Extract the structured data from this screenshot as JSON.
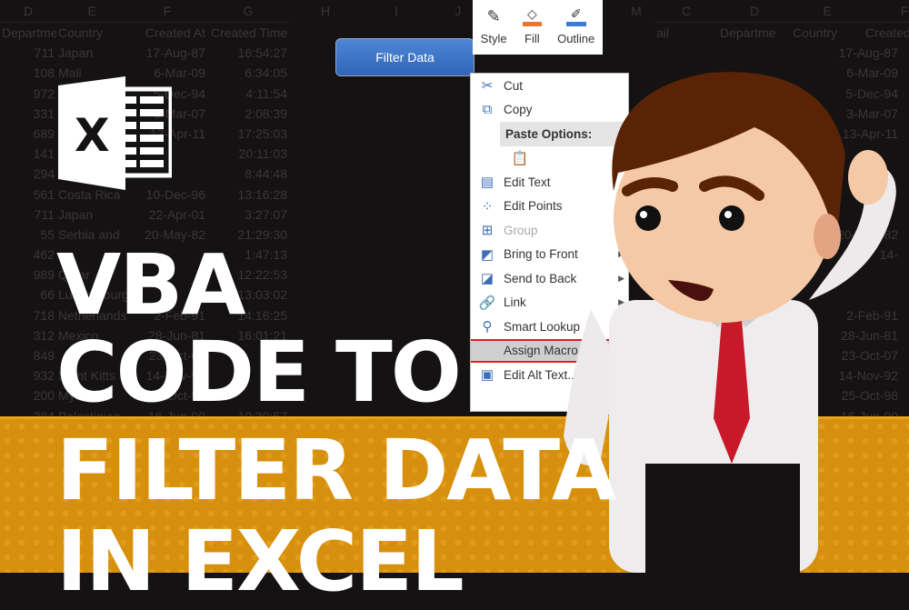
{
  "sheet_left": {
    "column_letters": [
      "D",
      "E",
      "F",
      "G",
      "H",
      "I",
      "J"
    ],
    "headers": [
      "Departme",
      "Country",
      "Created At",
      "Created Time"
    ],
    "rows": [
      [
        "711",
        "Japan",
        "17-Aug-87",
        "16:54:27"
      ],
      [
        "108",
        "Mali",
        "6-Mar-09",
        "6:34:05"
      ],
      [
        "972",
        "",
        "5-Dec-94",
        "4:11:54"
      ],
      [
        "331",
        "",
        "3-Mar-07",
        "2:08:39"
      ],
      [
        "689",
        "",
        "13-Apr-11",
        "17:25:03"
      ],
      [
        "141",
        "",
        "",
        "20:11:03"
      ],
      [
        "294",
        "",
        "",
        "8:44:48"
      ],
      [
        "561",
        "Costa Rica",
        "10-Dec-96",
        "13:16:28"
      ],
      [
        "711",
        "Japan",
        "22-Apr-01",
        "3:27:07"
      ],
      [
        "55",
        "Serbia and",
        "20-May-82",
        "21:29:30"
      ],
      [
        "462",
        "",
        "",
        "1:47:13"
      ],
      [
        "989",
        "Qatar",
        "",
        "12:22:53"
      ],
      [
        "66",
        "Luxembourg",
        "",
        "13:03:02"
      ],
      [
        "718",
        "Netherlands",
        "2-Feb-91",
        "14:16:25"
      ],
      [
        "312",
        "Mexico",
        "28-Jun-81",
        "16:01:21"
      ],
      [
        "849",
        "",
        "23-Oct-07",
        ""
      ],
      [
        "932",
        "Saint Kitts",
        "14-Nov-92",
        ""
      ],
      [
        "200",
        "Myanmar",
        "25-Oct-98",
        ""
      ],
      [
        "384",
        "Palestinian",
        "16-Jun-00",
        "10:30:57"
      ]
    ]
  },
  "sheet_right": {
    "column_letters": [
      "M",
      "C",
      "D",
      "E",
      "F"
    ],
    "headers": [
      "ail",
      "Departme",
      "Country",
      "Created At"
    ],
    "dates": [
      "17-Aug-87",
      "6-Mar-09",
      "5-Dec-94",
      "3-Mar-07",
      "13-Apr-11",
      "",
      "",
      "",
      "",
      "20-May-82",
      "14-",
      "",
      "",
      "2-Feb-91",
      "28-Jun-81",
      "23-Oct-07",
      "14-Nov-92",
      "25-Oct-98",
      "16-Jun-00"
    ]
  },
  "filter_button": {
    "label": "Filter Data",
    "color": "#3a72c4"
  },
  "ribbon": {
    "items": [
      {
        "label": "Style",
        "icon": "shape-style-icon"
      },
      {
        "label": "Fill",
        "icon": "paint-bucket-icon",
        "color": "#e8762d"
      },
      {
        "label": "Outline",
        "icon": "pen-outline-icon",
        "color": "#3a7bd5"
      }
    ]
  },
  "context_menu": {
    "items": [
      {
        "label": "Cut",
        "icon": "scissors-icon"
      },
      {
        "label": "Copy",
        "icon": "copy-icon"
      },
      {
        "label": "Paste Options:",
        "icon": "paste-icon",
        "header": true
      },
      {
        "label": "",
        "icon": "paste-icon"
      },
      {
        "label": "Edit Text",
        "icon": "edit-text-icon"
      },
      {
        "label": "Edit Points",
        "icon": "edit-points-icon"
      },
      {
        "label": "Group",
        "icon": "group-icon",
        "disabled": true
      },
      {
        "label": "Bring to Front",
        "icon": "bring-front-icon",
        "submenu": true
      },
      {
        "label": "Send to Back",
        "icon": "send-back-icon",
        "submenu": true
      },
      {
        "label": "Link",
        "icon": "link-icon",
        "submenu": true
      },
      {
        "label": "Smart Lookup",
        "icon": "smart-lookup-icon"
      },
      {
        "label": "Assign Macro...",
        "icon": "",
        "highlighted": true
      },
      {
        "label": "Edit Alt Text...",
        "icon": "alt-text-icon"
      }
    ]
  },
  "headline": {
    "lines": [
      "VBA",
      "CODE TO",
      "FILTER DATA",
      "IN EXCEL"
    ]
  },
  "colors": {
    "band": "#d6900e",
    "background": "#141212",
    "highlight": "#dd2222"
  }
}
